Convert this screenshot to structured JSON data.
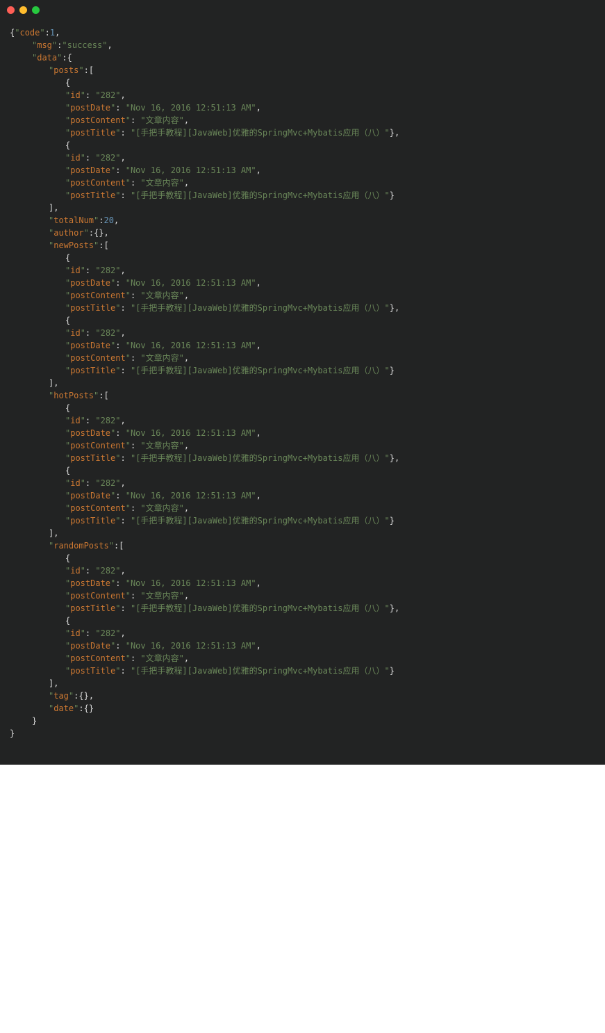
{
  "titlebar": {
    "dots": [
      "red",
      "yellow",
      "green"
    ]
  },
  "payload": {
    "code": 1,
    "msg": "success",
    "data": {
      "posts": [
        {
          "id": "282",
          "postDate": "Nov 16, 2016 12:51:13 AM",
          "postContent": "文章内容",
          "postTitle": "[手把手教程][JavaWeb]优雅的SpringMvc+Mybatis应用（八）"
        },
        {
          "id": "282",
          "postDate": "Nov 16, 2016 12:51:13 AM",
          "postContent": "文章内容",
          "postTitle": "[手把手教程][JavaWeb]优雅的SpringMvc+Mybatis应用（八）"
        }
      ],
      "totalNum": 20,
      "author": {},
      "newPosts": [
        {
          "id": "282",
          "postDate": "Nov 16, 2016 12:51:13 AM",
          "postContent": "文章内容",
          "postTitle": "[手把手教程][JavaWeb]优雅的SpringMvc+Mybatis应用（八）"
        },
        {
          "id": "282",
          "postDate": "Nov 16, 2016 12:51:13 AM",
          "postContent": "文章内容",
          "postTitle": "[手把手教程][JavaWeb]优雅的SpringMvc+Mybatis应用（八）"
        }
      ],
      "hotPosts": [
        {
          "id": "282",
          "postDate": "Nov 16, 2016 12:51:13 AM",
          "postContent": "文章内容",
          "postTitle": "[手把手教程][JavaWeb]优雅的SpringMvc+Mybatis应用（八）"
        },
        {
          "id": "282",
          "postDate": "Nov 16, 2016 12:51:13 AM",
          "postContent": "文章内容",
          "postTitle": "[手把手教程][JavaWeb]优雅的SpringMvc+Mybatis应用（八）"
        }
      ],
      "randomPosts": [
        {
          "id": "282",
          "postDate": "Nov 16, 2016 12:51:13 AM",
          "postContent": "文章内容",
          "postTitle": "[手把手教程][JavaWeb]优雅的SpringMvc+Mybatis应用（八）"
        },
        {
          "id": "282",
          "postDate": "Nov 16, 2016 12:51:13 AM",
          "postContent": "文章内容",
          "postTitle": "[手把手教程][JavaWeb]优雅的SpringMvc+Mybatis应用（八）"
        }
      ],
      "tag": {},
      "date": {}
    }
  }
}
